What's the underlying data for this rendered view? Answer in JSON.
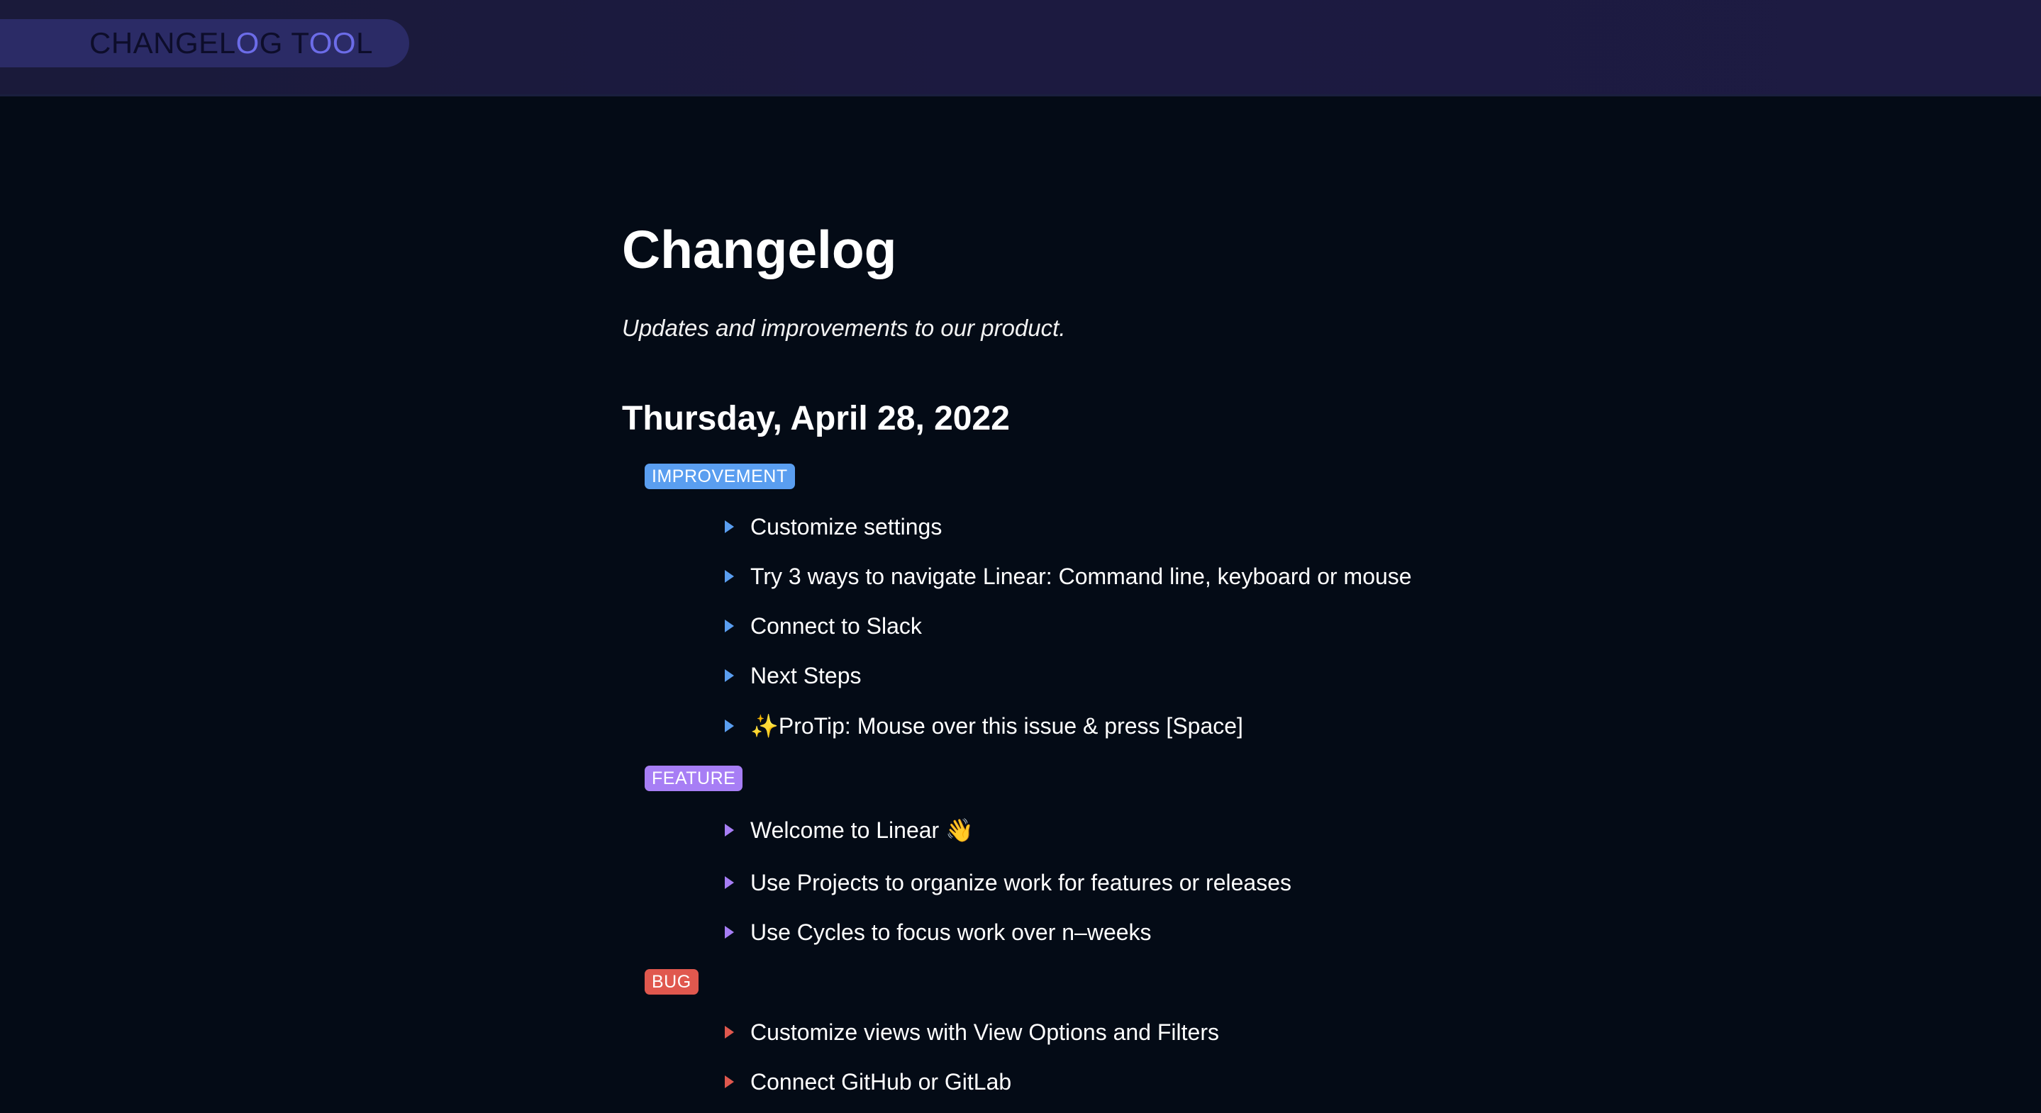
{
  "app": {
    "brand": "CHANGELOG TOOL"
  },
  "header": {
    "title": "Changelog",
    "subtitle": "Updates and improvements to our product."
  },
  "entries": [
    {
      "date": "Thursday, April 28, 2022",
      "groups": [
        {
          "label": "IMPROVEMENT",
          "color": "#5a9ef0",
          "items": [
            "Customize settings",
            "Try 3 ways to navigate Linear: Command line, keyboard or mouse",
            "Connect to Slack",
            "Next Steps",
            "✨ProTip: Mouse over this issue & press [Space]"
          ]
        },
        {
          "label": "FEATURE",
          "color": "#a77ef5",
          "items": [
            "Welcome to Linear 👋",
            "Use Projects to organize work for features or releases",
            "Use Cycles to focus work over n–weeks"
          ]
        },
        {
          "label": "BUG",
          "color": "#e0584e",
          "items": [
            "Customize views with View Options and Filters",
            "Connect GitHub or GitLab"
          ]
        }
      ]
    }
  ]
}
